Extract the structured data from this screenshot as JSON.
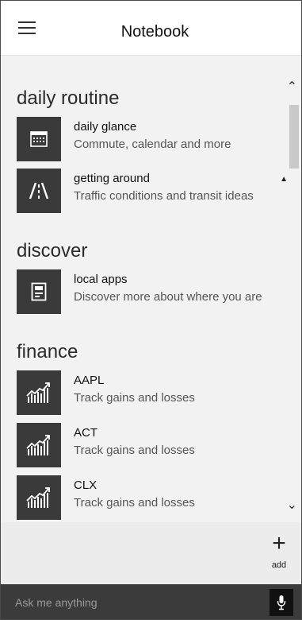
{
  "header": {
    "title": "Notebook"
  },
  "sections": {
    "daily": {
      "title": "daily routine",
      "items": [
        {
          "title": "daily glance",
          "subtitle": "Commute, calendar and more"
        },
        {
          "title": "getting around",
          "subtitle": "Traffic conditions and transit ideas"
        }
      ]
    },
    "discover": {
      "title": "discover",
      "items": [
        {
          "title": "local apps",
          "subtitle": "Discover more about where you are"
        }
      ]
    },
    "finance": {
      "title": "finance",
      "items": [
        {
          "title": "AAPL",
          "subtitle": "Track gains and losses"
        },
        {
          "title": "ACT",
          "subtitle": "Track gains and losses"
        },
        {
          "title": "CLX",
          "subtitle": "Track gains and losses"
        }
      ]
    }
  },
  "footer": {
    "add_label": "add"
  },
  "ask": {
    "placeholder": "Ask me anything"
  },
  "icons": {
    "menu": "hamburger-icon",
    "calendar": "calendar-icon",
    "road": "road-icon",
    "app": "local-app-icon",
    "stock": "stock-chart-icon",
    "bell": "bell-icon",
    "mic": "microphone-icon"
  },
  "colors": {
    "tile": "#3a3a3a",
    "askbar": "#3b3b3b",
    "content_bg": "#f2f2f2"
  }
}
